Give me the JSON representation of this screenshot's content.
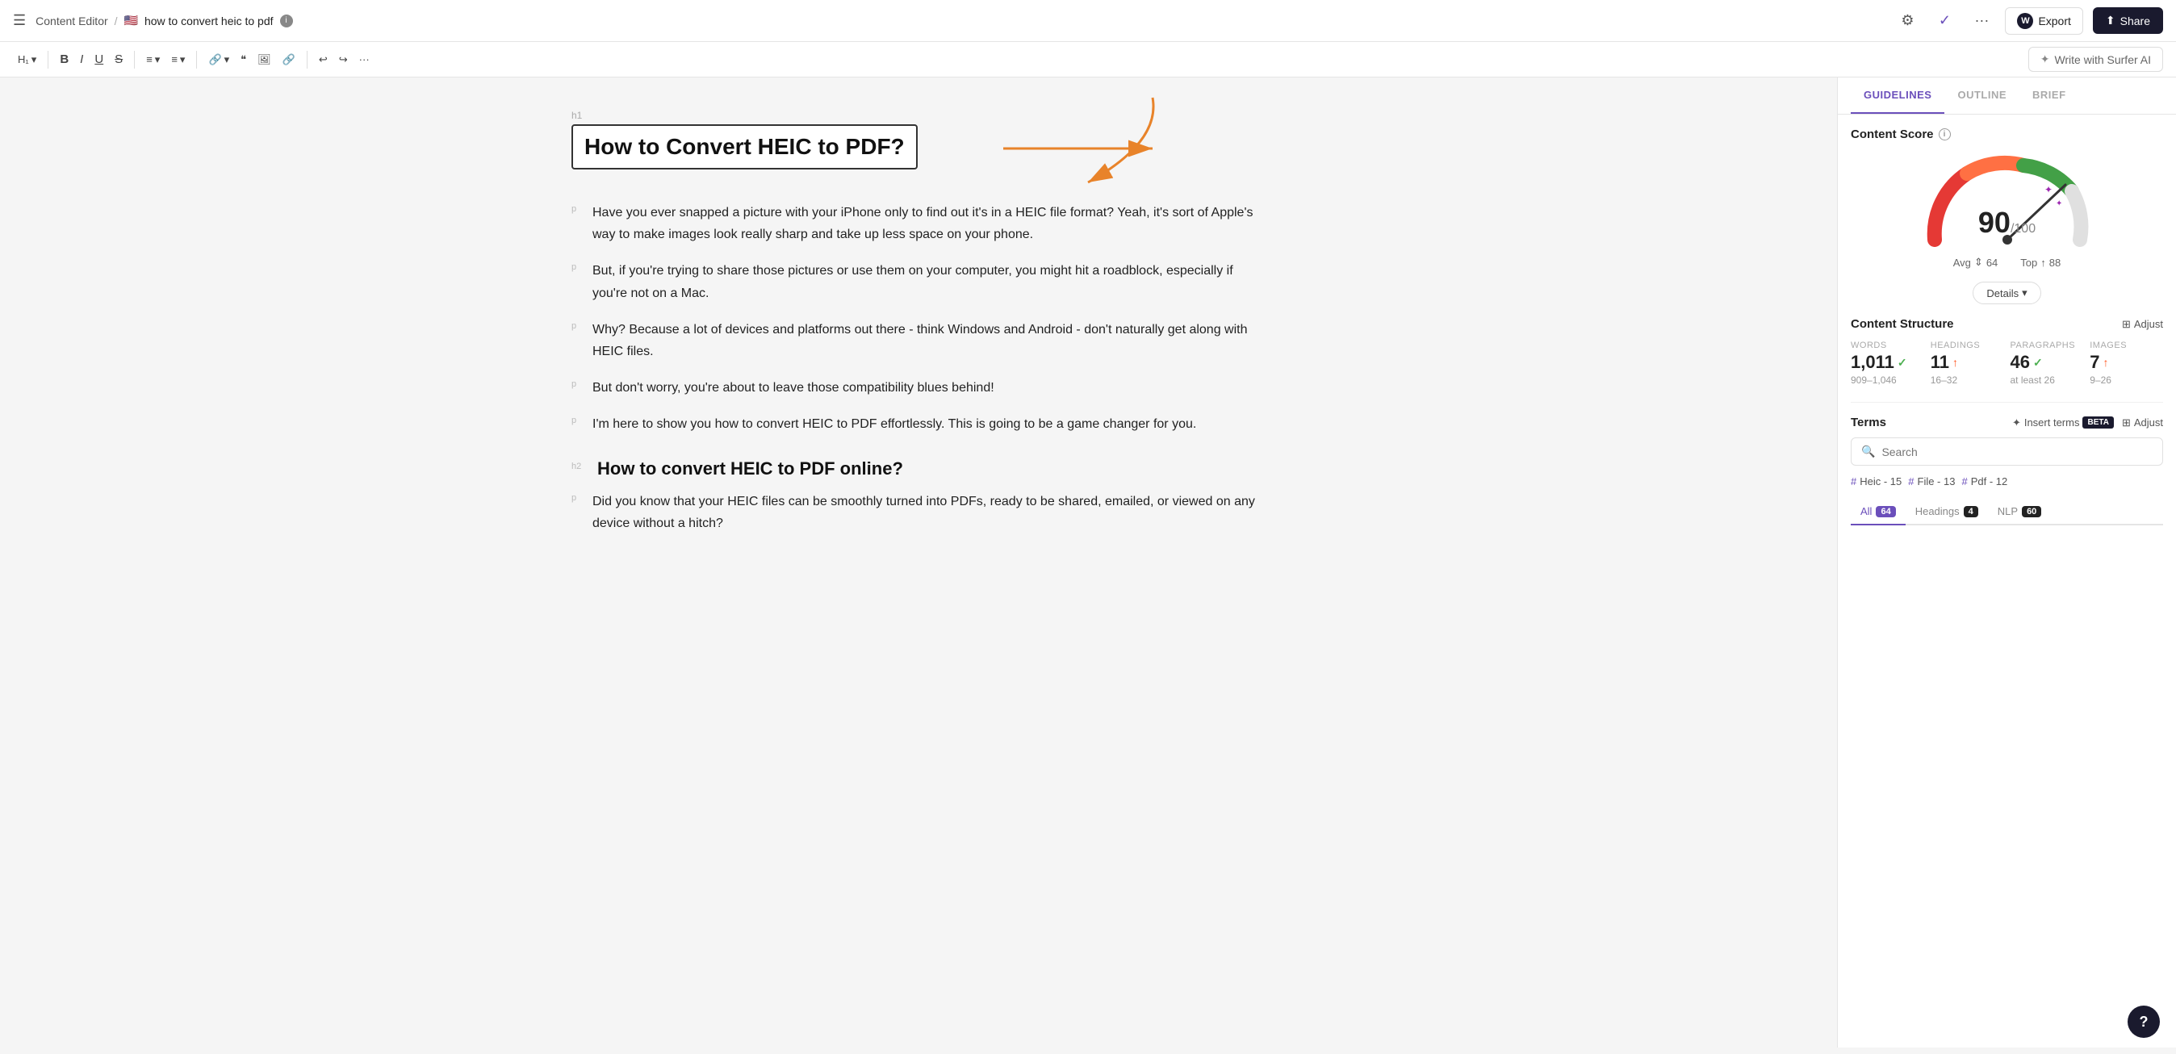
{
  "topnav": {
    "app_name": "Content Editor",
    "separator": "/",
    "flag": "🇺🇸",
    "doc_title": "how to convert heic to pdf",
    "export_label": "Export",
    "share_label": "Share",
    "wordpress_icon": "W"
  },
  "toolbar": {
    "heading_label": "H₁",
    "bold_label": "B",
    "italic_label": "I",
    "underline_label": "U",
    "strikethrough_label": "S",
    "align_label": "≡",
    "list_label": "≡",
    "write_ai_label": "Write with Surfer AI"
  },
  "editor": {
    "h1_tag": "h1",
    "h1_title": "How to Convert HEIC to PDF?",
    "paragraphs": [
      {
        "tag": "p",
        "text": "Have you ever snapped a picture with your iPhone only to find out it's in a HEIC file format? Yeah, it's sort of Apple's way to make images look really sharp and take up less space on your phone."
      },
      {
        "tag": "p",
        "text": "But, if you're trying to share those pictures or use them on your computer, you might hit a roadblock, especially if you're not on a Mac."
      },
      {
        "tag": "p",
        "text": "Why? Because a lot of devices and platforms out there - think Windows and Android - don't naturally get along with HEIC files."
      },
      {
        "tag": "p",
        "text": "But don't worry, you're about to leave those compatibility blues behind!"
      },
      {
        "tag": "p",
        "text": "I'm here to show you how to convert HEIC to PDF effortlessly. This is going to be a game changer for you."
      }
    ],
    "h2_tag": "h2",
    "h2_title": "How to convert HEIC to PDF online?",
    "h2_para": "Did you know that your HEIC files can be smoothly turned into PDFs, ready to be shared, emailed, or viewed on any device without a hitch?"
  },
  "sidebar": {
    "tabs": [
      "GUIDELINES",
      "OUTLINE",
      "BRIEF"
    ],
    "active_tab": "GUIDELINES",
    "score": {
      "title": "Content Score",
      "value": "90",
      "max": "/100",
      "avg_label": "Avg",
      "avg_value": "64",
      "top_label": "Top",
      "top_value": "88"
    },
    "details_label": "Details",
    "content_structure": {
      "title": "Content Structure",
      "adjust_label": "Adjust",
      "items": [
        {
          "label": "WORDS",
          "value": "1,011",
          "status": "check",
          "range": "909–1,046"
        },
        {
          "label": "HEADINGS",
          "value": "11",
          "status": "up",
          "range": "16–32"
        },
        {
          "label": "PARAGRAPHS",
          "value": "46",
          "status": "check",
          "range": "at least 26"
        },
        {
          "label": "IMAGES",
          "value": "7",
          "status": "up",
          "range": "9–26"
        }
      ]
    },
    "terms": {
      "title": "Terms",
      "beta_label": "BETA",
      "insert_label": "Insert terms",
      "adjust_label": "Adjust",
      "search_placeholder": "Search",
      "tags": [
        {
          "hash": "#",
          "term": "Heic",
          "count": "15"
        },
        {
          "hash": "#",
          "term": "File",
          "count": "13"
        },
        {
          "hash": "#",
          "term": "Pdf",
          "count": "12"
        }
      ],
      "filter_tabs": [
        {
          "label": "All",
          "badge": "64",
          "badge_type": "purple"
        },
        {
          "label": "Headings",
          "badge": "4",
          "badge_type": "dark"
        },
        {
          "label": "NLP",
          "badge": "60",
          "badge_type": "dark"
        }
      ],
      "active_filter": "All"
    }
  },
  "icons": {
    "search": "🔍",
    "gear": "⚙",
    "check_circle": "✓",
    "dots": "···",
    "undo": "↩",
    "redo": "↪",
    "link": "🔗",
    "image": "🖼",
    "ai_sparkle": "✦",
    "chevron_down": "▾",
    "up_arrow": "↑",
    "avg_arrow": "⇕",
    "share_icon": "⬆",
    "wp_icon": "W",
    "question": "?"
  }
}
